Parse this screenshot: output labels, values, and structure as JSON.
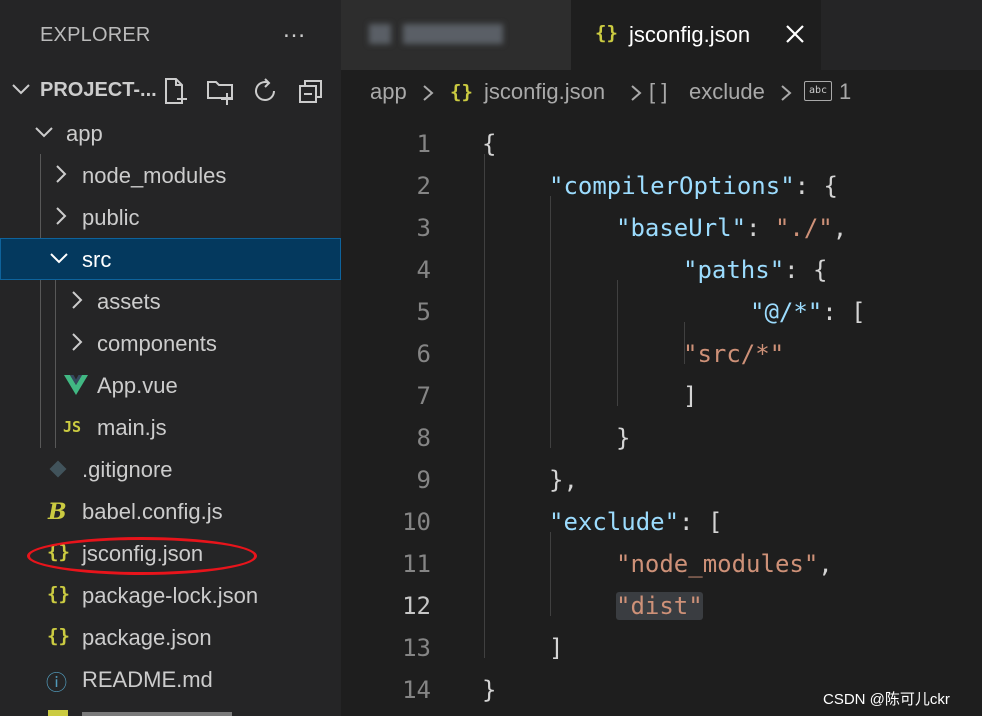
{
  "sidebar": {
    "title": "EXPLORER",
    "more_icon": "…",
    "project": {
      "label": "PROJECT-...",
      "actions": [
        "new-file-icon",
        "new-folder-icon",
        "refresh-icon",
        "collapse-all-icon"
      ]
    },
    "tree": [
      {
        "label": "app",
        "icon": "chevron-down",
        "depth": 0
      },
      {
        "label": "node_modules",
        "icon": "chevron-right",
        "depth": 1
      },
      {
        "label": "public",
        "icon": "chevron-right",
        "depth": 1
      },
      {
        "label": "src",
        "icon": "chevron-down",
        "depth": 1,
        "selected": true
      },
      {
        "label": "assets",
        "icon": "chevron-right",
        "depth": 2
      },
      {
        "label": "components",
        "icon": "chevron-right",
        "depth": 2
      },
      {
        "label": "App.vue",
        "icon": "vue-icon",
        "depth": 2
      },
      {
        "label": "main.js",
        "icon": "js-icon",
        "glyph": "JS",
        "depth": 2
      },
      {
        "label": ".gitignore",
        "icon": "git-icon",
        "depth": 1
      },
      {
        "label": "babel.config.js",
        "icon": "babel-icon",
        "glyph": "B",
        "depth": 1
      },
      {
        "label": "jsconfig.json",
        "icon": "json-icon",
        "glyph": "{}",
        "depth": 1
      },
      {
        "label": "package-lock.json",
        "icon": "json-icon",
        "glyph": "{}",
        "depth": 1
      },
      {
        "label": "package.json",
        "icon": "json-icon",
        "glyph": "{}",
        "depth": 1
      },
      {
        "label": "README.md",
        "icon": "info-icon",
        "glyph": "ⓘ",
        "depth": 1
      }
    ]
  },
  "tabs": {
    "active": {
      "icon": "{}",
      "label": "jsconfig.json",
      "close": "✕"
    }
  },
  "breadcrumb": {
    "items": [
      "app",
      "{}",
      "jsconfig.json",
      "[ ]",
      "exclude",
      "abc",
      "1"
    ]
  },
  "editor": {
    "line_numbers": [
      "1",
      "2",
      "3",
      "4",
      "5",
      "6",
      "7",
      "8",
      "9",
      "10",
      "11",
      "12",
      "13",
      "14"
    ],
    "active_line": "12",
    "lines": [
      [
        {
          "t": "{",
          "c": "p"
        }
      ],
      [
        {
          "t": "\"compilerOptions\"",
          "c": "k"
        },
        {
          "t": ": {",
          "c": "p"
        }
      ],
      [
        {
          "t": "\"baseUrl\"",
          "c": "k"
        },
        {
          "t": ": ",
          "c": "p"
        },
        {
          "t": "\"./\"",
          "c": "s"
        },
        {
          "t": ",",
          "c": "p"
        }
      ],
      [
        {
          "t": "\"paths\"",
          "c": "k"
        },
        {
          "t": ": {",
          "c": "p"
        }
      ],
      [
        {
          "t": "\"@/*\"",
          "c": "k"
        },
        {
          "t": ": [",
          "c": "p"
        }
      ],
      [
        {
          "t": "\"src/*\"",
          "c": "s"
        }
      ],
      [
        {
          "t": "]",
          "c": "p"
        }
      ],
      [
        {
          "t": "}",
          "c": "p"
        }
      ],
      [
        {
          "t": "},",
          "c": "p"
        }
      ],
      [
        {
          "t": "\"exclude\"",
          "c": "k"
        },
        {
          "t": ": [",
          "c": "p"
        }
      ],
      [
        {
          "t": "\"node_modules\"",
          "c": "s"
        },
        {
          "t": ",",
          "c": "p"
        }
      ],
      [
        {
          "t": "\"dist\"",
          "c": "s hl"
        }
      ],
      [
        {
          "t": "]",
          "c": "p"
        }
      ],
      [
        {
          "t": "}",
          "c": "p"
        }
      ]
    ]
  },
  "watermark": "CSDN @陈可儿ckr",
  "colors": {
    "selection": "#04395e",
    "annotation": "#e8141b",
    "json_icon": "#cbcb41",
    "vue": "#41b883"
  }
}
